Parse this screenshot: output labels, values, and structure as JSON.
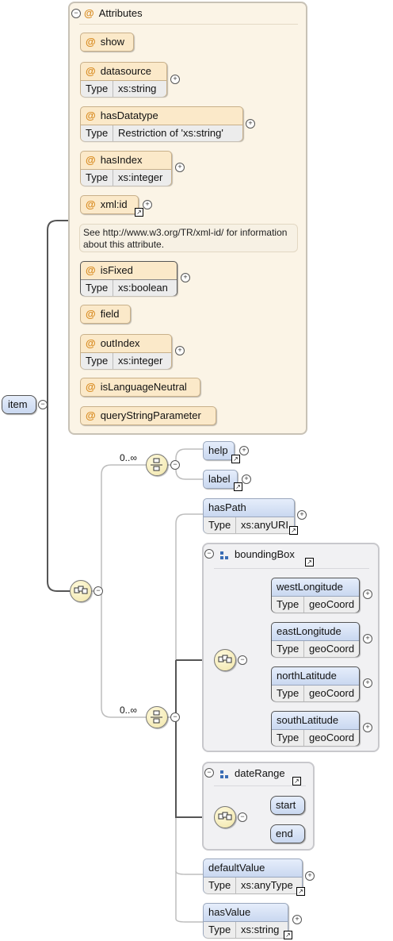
{
  "root": {
    "label": "item"
  },
  "attributes_panel": {
    "title": "Attributes",
    "attrs": [
      {
        "name": "show"
      },
      {
        "name": "datasource",
        "type_key": "Type",
        "type": "xs:string"
      },
      {
        "name": "hasDatatype",
        "type_key": "Type",
        "type": "Restriction of 'xs:string'"
      },
      {
        "name": "hasIndex",
        "type_key": "Type",
        "type": "xs:integer"
      },
      {
        "name": "xml:id"
      },
      {
        "name": "isFixed",
        "type_key": "Type",
        "type": "xs:boolean"
      },
      {
        "name": "field"
      },
      {
        "name": "outIndex",
        "type_key": "Type",
        "type": "xs:integer"
      },
      {
        "name": "isLanguageNeutral"
      },
      {
        "name": "queryStringParameter"
      }
    ],
    "xmlid_note": "See http://www.w3.org/TR/xml-id/ for information about this attribute."
  },
  "choice1": {
    "cardinality": "0..∞",
    "elements": [
      {
        "name": "help"
      },
      {
        "name": "label"
      }
    ]
  },
  "choice2": {
    "cardinality": "0..∞",
    "hasPath": {
      "name": "hasPath",
      "type_key": "Type",
      "type": "xs:anyURI"
    },
    "boundingBox": {
      "title": "boundingBox",
      "elements": [
        {
          "name": "westLongitude",
          "type_key": "Type",
          "type": "geoCoord"
        },
        {
          "name": "eastLongitude",
          "type_key": "Type",
          "type": "geoCoord"
        },
        {
          "name": "northLatitude",
          "type_key": "Type",
          "type": "geoCoord"
        },
        {
          "name": "southLatitude",
          "type_key": "Type",
          "type": "geoCoord"
        }
      ]
    },
    "dateRange": {
      "title": "dateRange",
      "elements": [
        {
          "name": "start"
        },
        {
          "name": "end"
        }
      ]
    },
    "defaultValue": {
      "name": "defaultValue",
      "type_key": "Type",
      "type": "xs:anyType"
    },
    "hasValue": {
      "name": "hasValue",
      "type_key": "Type",
      "type": "xs:string"
    }
  },
  "symbols": {
    "expand": "+",
    "collapse": "−",
    "attr_marker": "@",
    "link": "↗"
  }
}
